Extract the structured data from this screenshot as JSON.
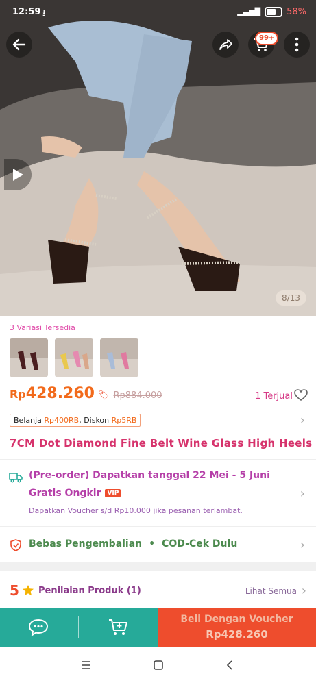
{
  "status": {
    "time": "12:59",
    "battery_pct": "58%"
  },
  "gallery": {
    "counter": "8/13",
    "cart_badge": "99+"
  },
  "variants": {
    "label": "3 Variasi Tersedia"
  },
  "price": {
    "currency": "Rp",
    "value": "428.260",
    "original": "Rp884.000",
    "sold": "1 Terjual"
  },
  "promo": {
    "prefix": "Belanja ",
    "amount1": "Rp400RB",
    "middle": ", Diskon ",
    "amount2": "Rp5RB"
  },
  "product": {
    "title": "7CM Dot Diamond Fine Belt Wine Glass High Heels"
  },
  "shipping": {
    "line1": "(Pre-order) Dapatkan tanggal 22 Mei - 5 Juni",
    "free_label": "Gratis Ongkir",
    "vip": "VIP",
    "note": "Dapatkan Voucher s/d Rp10.000 jika pesanan terlambat."
  },
  "returns": {
    "label1": "Bebas Pengembalian",
    "dot": "•",
    "label2": "COD-Cek Dulu"
  },
  "rating": {
    "score": "5",
    "label": "Penilaian Produk (1)",
    "see_all": "Lihat Semua"
  },
  "bottom": {
    "buy_label": "Beli Dengan Voucher",
    "buy_price": "Rp428.260"
  },
  "colors": {
    "accent": "#ee4d2d",
    "teal": "#26aa99"
  }
}
